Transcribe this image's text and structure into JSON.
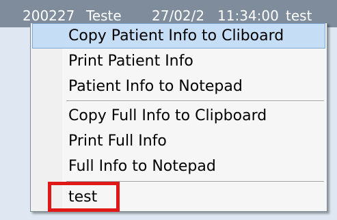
{
  "background_row": {
    "top_line": [
      "",
      "",
      "",
      "",
      ""
    ],
    "cells": [
      "200227",
      "Teste",
      "27/02/2",
      "11:34:00",
      "test"
    ]
  },
  "menu": {
    "items": [
      {
        "label": "Copy Patient Info to Cliboard",
        "highlighted": true
      },
      {
        "label": "Print Patient Info"
      },
      {
        "label": "Patient Info to Notepad"
      },
      {
        "label": "Copy Full Info to Clipboard"
      },
      {
        "label": "Print Full Info"
      },
      {
        "label": "Full Info to Notepad"
      },
      {
        "label": "test"
      }
    ]
  },
  "colors": {
    "highlight_bg": "#c6def5",
    "highlight_border": "#7aa7d6",
    "annotation_box": "#e01818",
    "row_bg": "#7e8c9c"
  }
}
